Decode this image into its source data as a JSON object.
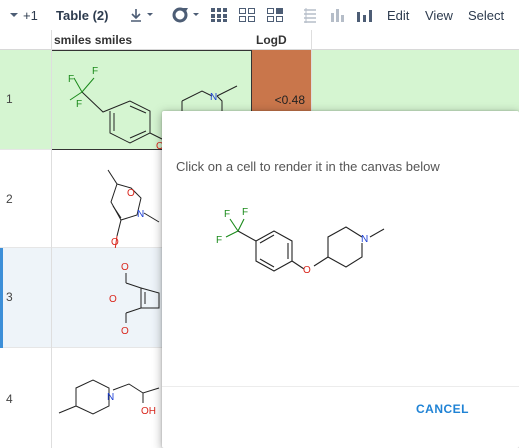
{
  "toolbar": {
    "plus_label": "+1",
    "table_title": "Table (2)",
    "edit_label": "Edit",
    "view_label": "View",
    "select_label": "Select",
    "icons": [
      "chevron-down-icon",
      "download-icon",
      "refresh-icon",
      "grid-view-icon",
      "grid-outline-icon",
      "grid-alt-icon",
      "list-icon",
      "column-chart-icon",
      "bar-chart-icon"
    ]
  },
  "grid": {
    "columns": [
      "smiles smiles",
      "LogD"
    ],
    "rows": [
      {
        "number": "1",
        "logd": "<0.48",
        "selected": true,
        "logd_color": "#c9764b"
      },
      {
        "number": "2",
        "logd": "",
        "selected": false,
        "logd_color": ""
      },
      {
        "number": "3",
        "logd": "",
        "selected": false,
        "logd_color": ""
      },
      {
        "number": "4",
        "logd": "",
        "selected": false,
        "logd_color": "#f79a9a"
      }
    ],
    "atom_labels": {
      "F": "F",
      "O": "O",
      "N": "N",
      "OH": "OH"
    },
    "colors": {
      "selected_row": "#d5f5d1",
      "current_row": "#eef4f9",
      "current_marker": "#3d8fd8"
    }
  },
  "dialog": {
    "message": "Click on a cell to render it in the canvas below",
    "cancel_label": "CANCEL",
    "accent_color": "#2083d5"
  }
}
